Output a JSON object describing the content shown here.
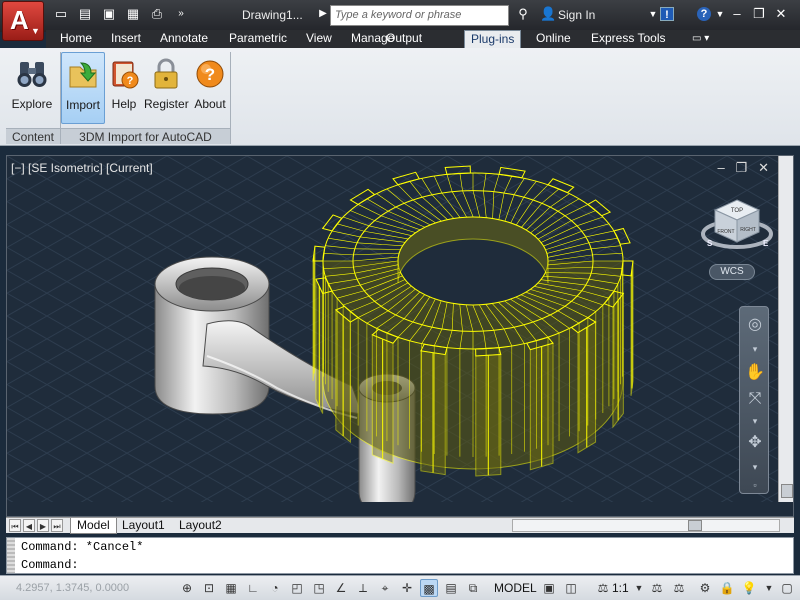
{
  "titlebar": {
    "doc_title": "Drawing1...",
    "search_placeholder": "Type a keyword or phrase",
    "signin_label": "Sign In"
  },
  "tabs": [
    {
      "label": "Home"
    },
    {
      "label": "Insert"
    },
    {
      "label": "Annotate"
    },
    {
      "label": "Parametric"
    },
    {
      "label": "View"
    },
    {
      "label": "Manage"
    },
    {
      "label": "Output"
    },
    {
      "label": "Plug-ins",
      "active": true
    },
    {
      "label": "Online"
    },
    {
      "label": "Express Tools"
    }
  ],
  "ribbon": {
    "buttons": [
      {
        "label": "Explore",
        "icon": "binoculars-icon"
      },
      {
        "label": "Import",
        "icon": "import-folder-icon",
        "selected": true
      },
      {
        "label": "Help",
        "icon": "help-book-icon"
      },
      {
        "label": "Register",
        "icon": "padlock-icon"
      },
      {
        "label": "About",
        "icon": "question-orb-icon"
      }
    ],
    "panels": [
      {
        "title": "Content"
      },
      {
        "title": "3DM Import for AutoCAD"
      }
    ]
  },
  "viewport": {
    "label": "[−] [SE Isometric] [Current]",
    "wcs_label": "WCS",
    "selection_color": "#ffff00",
    "background_color": "#1f2c3b",
    "viewcube_faces": {
      "top": "TOP",
      "front": "FRONT",
      "right": "RIGHT"
    },
    "compass": {
      "s": "S",
      "e": "E"
    }
  },
  "layout_tabs": [
    {
      "label": "Model",
      "active": true
    },
    {
      "label": "Layout1"
    },
    {
      "label": "Layout2"
    }
  ],
  "command": {
    "history_line": "Command: *Cancel*",
    "prompt": "Command:"
  },
  "statusbar": {
    "coordinates": "4.2957, 1.3745, 0.0000",
    "model_label": "MODEL",
    "annotation_scale": "1:1"
  }
}
